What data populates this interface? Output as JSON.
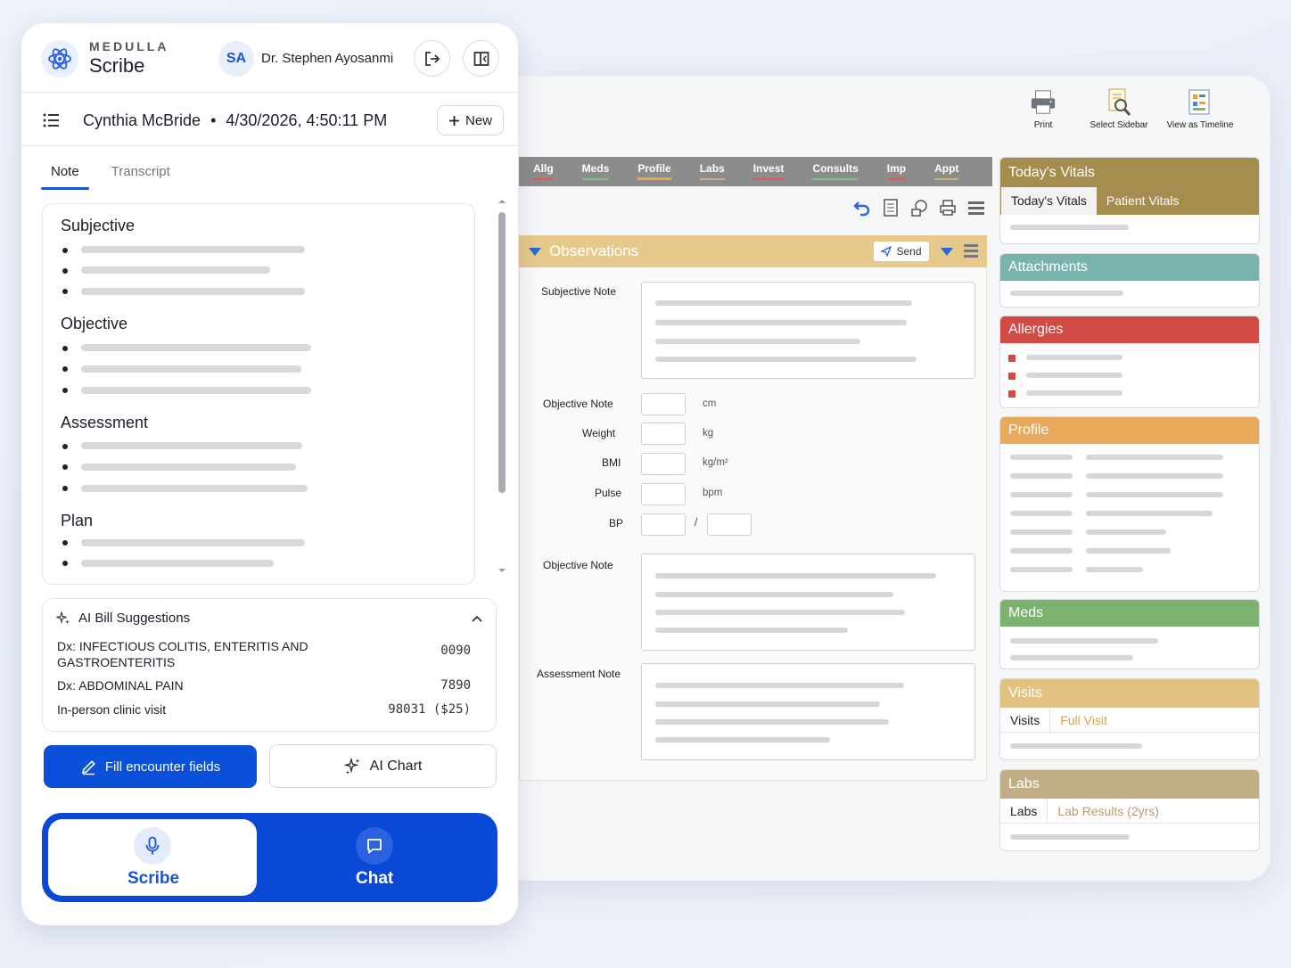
{
  "emr": {
    "toolbar": [
      {
        "label": "Print",
        "icon": "printer-icon"
      },
      {
        "label": "Select Sidebar",
        "icon": "document-search-icon"
      },
      {
        "label": "View as Timeline",
        "icon": "timeline-icon"
      }
    ],
    "tabs": [
      {
        "label": "Allg",
        "color": "#e05a4f"
      },
      {
        "label": "Meds",
        "color": "#7bc47f"
      },
      {
        "label": "Profile",
        "color": "#f0a640",
        "active": true
      },
      {
        "label": "Labs",
        "color": "#c9b27a"
      },
      {
        "label": "Invest",
        "color": "#e05a4f"
      },
      {
        "label": "Consults",
        "color": "#7bc47f"
      },
      {
        "label": "Imp",
        "color": "#e05a4f"
      },
      {
        "label": "Appt",
        "color": "#c9b27a"
      }
    ],
    "observations": {
      "title": "Observations",
      "send_label": "Send",
      "subjective_label": "Subjective Note",
      "objective_label": "Objective Note",
      "fields": [
        {
          "label": "Objective Note",
          "unit": "cm"
        },
        {
          "label": "Weight",
          "unit": "kg"
        },
        {
          "label": "BMI",
          "unit": "kg/m²"
        },
        {
          "label": "Pulse",
          "unit": "bpm"
        },
        {
          "label": "BP",
          "unit": "/"
        }
      ],
      "objective_note2_label": "Objective Note",
      "assessment_label": "Assessment Note"
    },
    "sidebar": {
      "todays_vitals": {
        "title": "Today's Vitals",
        "tabs": [
          "Today's Vitals",
          "Patient Vitals"
        ],
        "color": "#a58c4f"
      },
      "attachments": {
        "title": "Attachments",
        "color": "#78b3ad"
      },
      "allergies": {
        "title": "Allergies",
        "color": "#d24a44"
      },
      "profile": {
        "title": "Profile",
        "color": "#e8a95a"
      },
      "meds": {
        "title": "Meds",
        "color": "#7cb26f"
      },
      "visits": {
        "title": "Visits",
        "tabs": [
          "Visits",
          "Full Visit"
        ],
        "color": "#e1c280"
      },
      "labs": {
        "title": "Labs",
        "tabs": [
          "Labs",
          "Lab Results (2yrs)"
        ],
        "color": "#c2ae86"
      }
    }
  },
  "scribe": {
    "brand_top": "MEDULLA",
    "brand_bottom": "Scribe",
    "avatar_initials": "SA",
    "doctor_name": "Dr. Stephen Ayosanmi",
    "patient": "Cynthia McBride",
    "datetime": "4/30/2026, 4:50:11 PM",
    "separator": "•",
    "new_label": "New",
    "tabs": [
      {
        "label": "Note",
        "active": true
      },
      {
        "label": "Transcript"
      }
    ],
    "note_sections": [
      "Subjective",
      "Objective",
      "Assessment",
      "Plan"
    ],
    "bill": {
      "title": "AI Bill Suggestions",
      "rows": [
        {
          "desc": "Dx: INFECTIOUS COLITIS, ENTERITIS AND GASTROENTERITIS",
          "code": "0090"
        },
        {
          "desc": "Dx: ABDOMINAL PAIN",
          "code": "7890"
        },
        {
          "desc": "In-person clinic visit",
          "code": "98031 ($25)"
        }
      ]
    },
    "fill_label": "Fill encounter fields",
    "ai_chart_label": "AI Chart",
    "mode_scribe": "Scribe",
    "mode_chat": "Chat",
    "accent": "#0a50d8"
  }
}
